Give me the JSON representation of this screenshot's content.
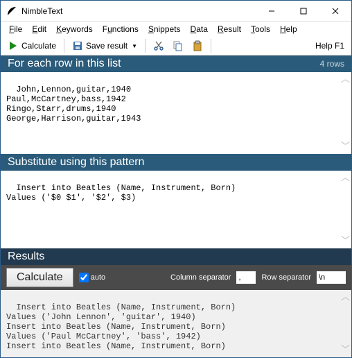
{
  "window": {
    "title": "NimbleText"
  },
  "menu": {
    "file": "File",
    "edit": "Edit",
    "keywords": "Keywords",
    "functions": "Functions",
    "snippets": "Snippets",
    "data": "Data",
    "result": "Result",
    "tools": "Tools",
    "help": "Help"
  },
  "toolbar": {
    "calculate": "Calculate",
    "save_result": "Save result",
    "help": "Help F1"
  },
  "input_section": {
    "title": "For each row in this list",
    "row_count": "4 rows",
    "content": "John,Lennon,guitar,1940\nPaul,McCartney,bass,1942\nRingo,Starr,drums,1940\nGeorge,Harrison,guitar,1943"
  },
  "pattern_section": {
    "title": "Substitute using this pattern",
    "content": "Insert into Beatles (Name, Instrument, Born)\nValues ('$0 $1', '$2', $3)"
  },
  "results_section": {
    "title": "Results",
    "calculate_btn": "Calculate",
    "auto_label": "auto",
    "auto_checked": true,
    "col_sep_label": "Column separator",
    "col_sep_value": ",",
    "row_sep_label": "Row separator",
    "row_sep_value": "\\n",
    "content": "Insert into Beatles (Name, Instrument, Born)\nValues ('John Lennon', 'guitar', 1940)\nInsert into Beatles (Name, Instrument, Born)\nValues ('Paul McCartney', 'bass', 1942)\nInsert into Beatles (Name, Instrument, Born)"
  }
}
